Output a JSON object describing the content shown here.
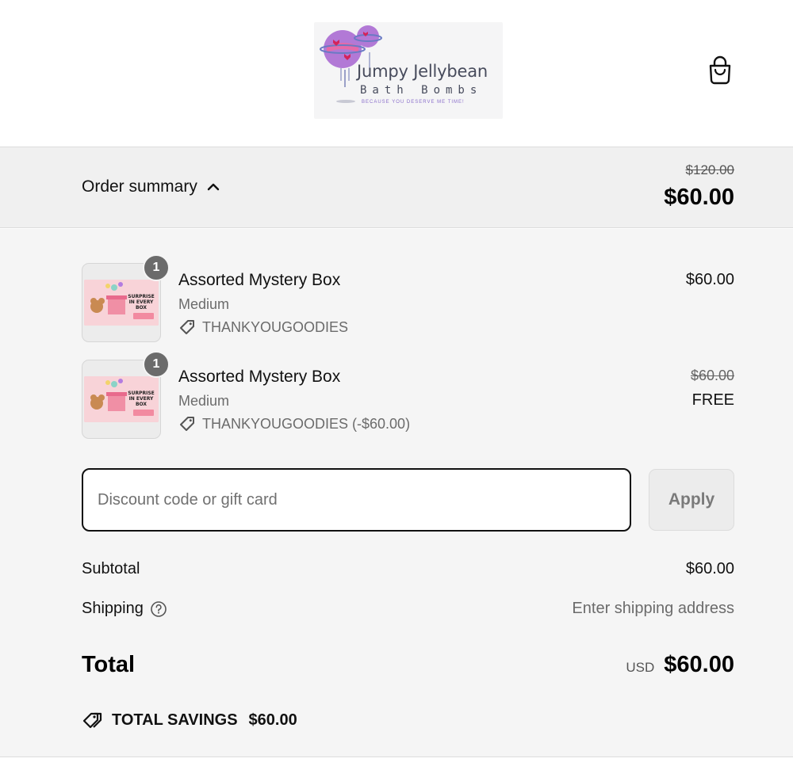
{
  "header": {
    "logo": {
      "title": "Jumpy Jellybean",
      "subtitle": "Bath Bombs",
      "tagline": "Because you deserve me time!"
    },
    "cart_icon": "shopping-bag-icon"
  },
  "summary_bar": {
    "label": "Order summary",
    "toggle_icon": "chevron-up-icon",
    "compare_total": "$120.00",
    "total": "$60.00"
  },
  "line_items": [
    {
      "quantity": "1",
      "title": "Assorted Mystery Box",
      "variant": "Medium",
      "discount": "THANKYOUGOODIES",
      "price": "$60.00",
      "thumb_text": "SURPRISE IN EVERY BOX"
    },
    {
      "quantity": "1",
      "title": "Assorted Mystery Box",
      "variant": "Medium",
      "discount": "THANKYOUGOODIES (-$60.00)",
      "compare_price": "$60.00",
      "price": "FREE",
      "thumb_text": "SURPRISE IN EVERY BOX"
    }
  ],
  "discount_form": {
    "placeholder": "Discount code or gift card",
    "value": "",
    "apply_label": "Apply"
  },
  "totals": {
    "subtotal_label": "Subtotal",
    "subtotal_value": "$60.00",
    "shipping_label": "Shipping",
    "shipping_value": "Enter shipping address",
    "total_label": "Total",
    "currency": "USD",
    "total_value": "$60.00"
  },
  "savings": {
    "label": "TOTAL SAVINGS",
    "amount": "$60.00"
  },
  "colors": {
    "header_bg": "#ffffff",
    "summary_bg": "#f0f0f0",
    "body_bg": "#f5f5f5",
    "badge_bg": "#6b6b6b",
    "muted_text": "#6b6b6b",
    "logo_purple": "#8a6ecb",
    "logo_pink": "#e0508a"
  }
}
